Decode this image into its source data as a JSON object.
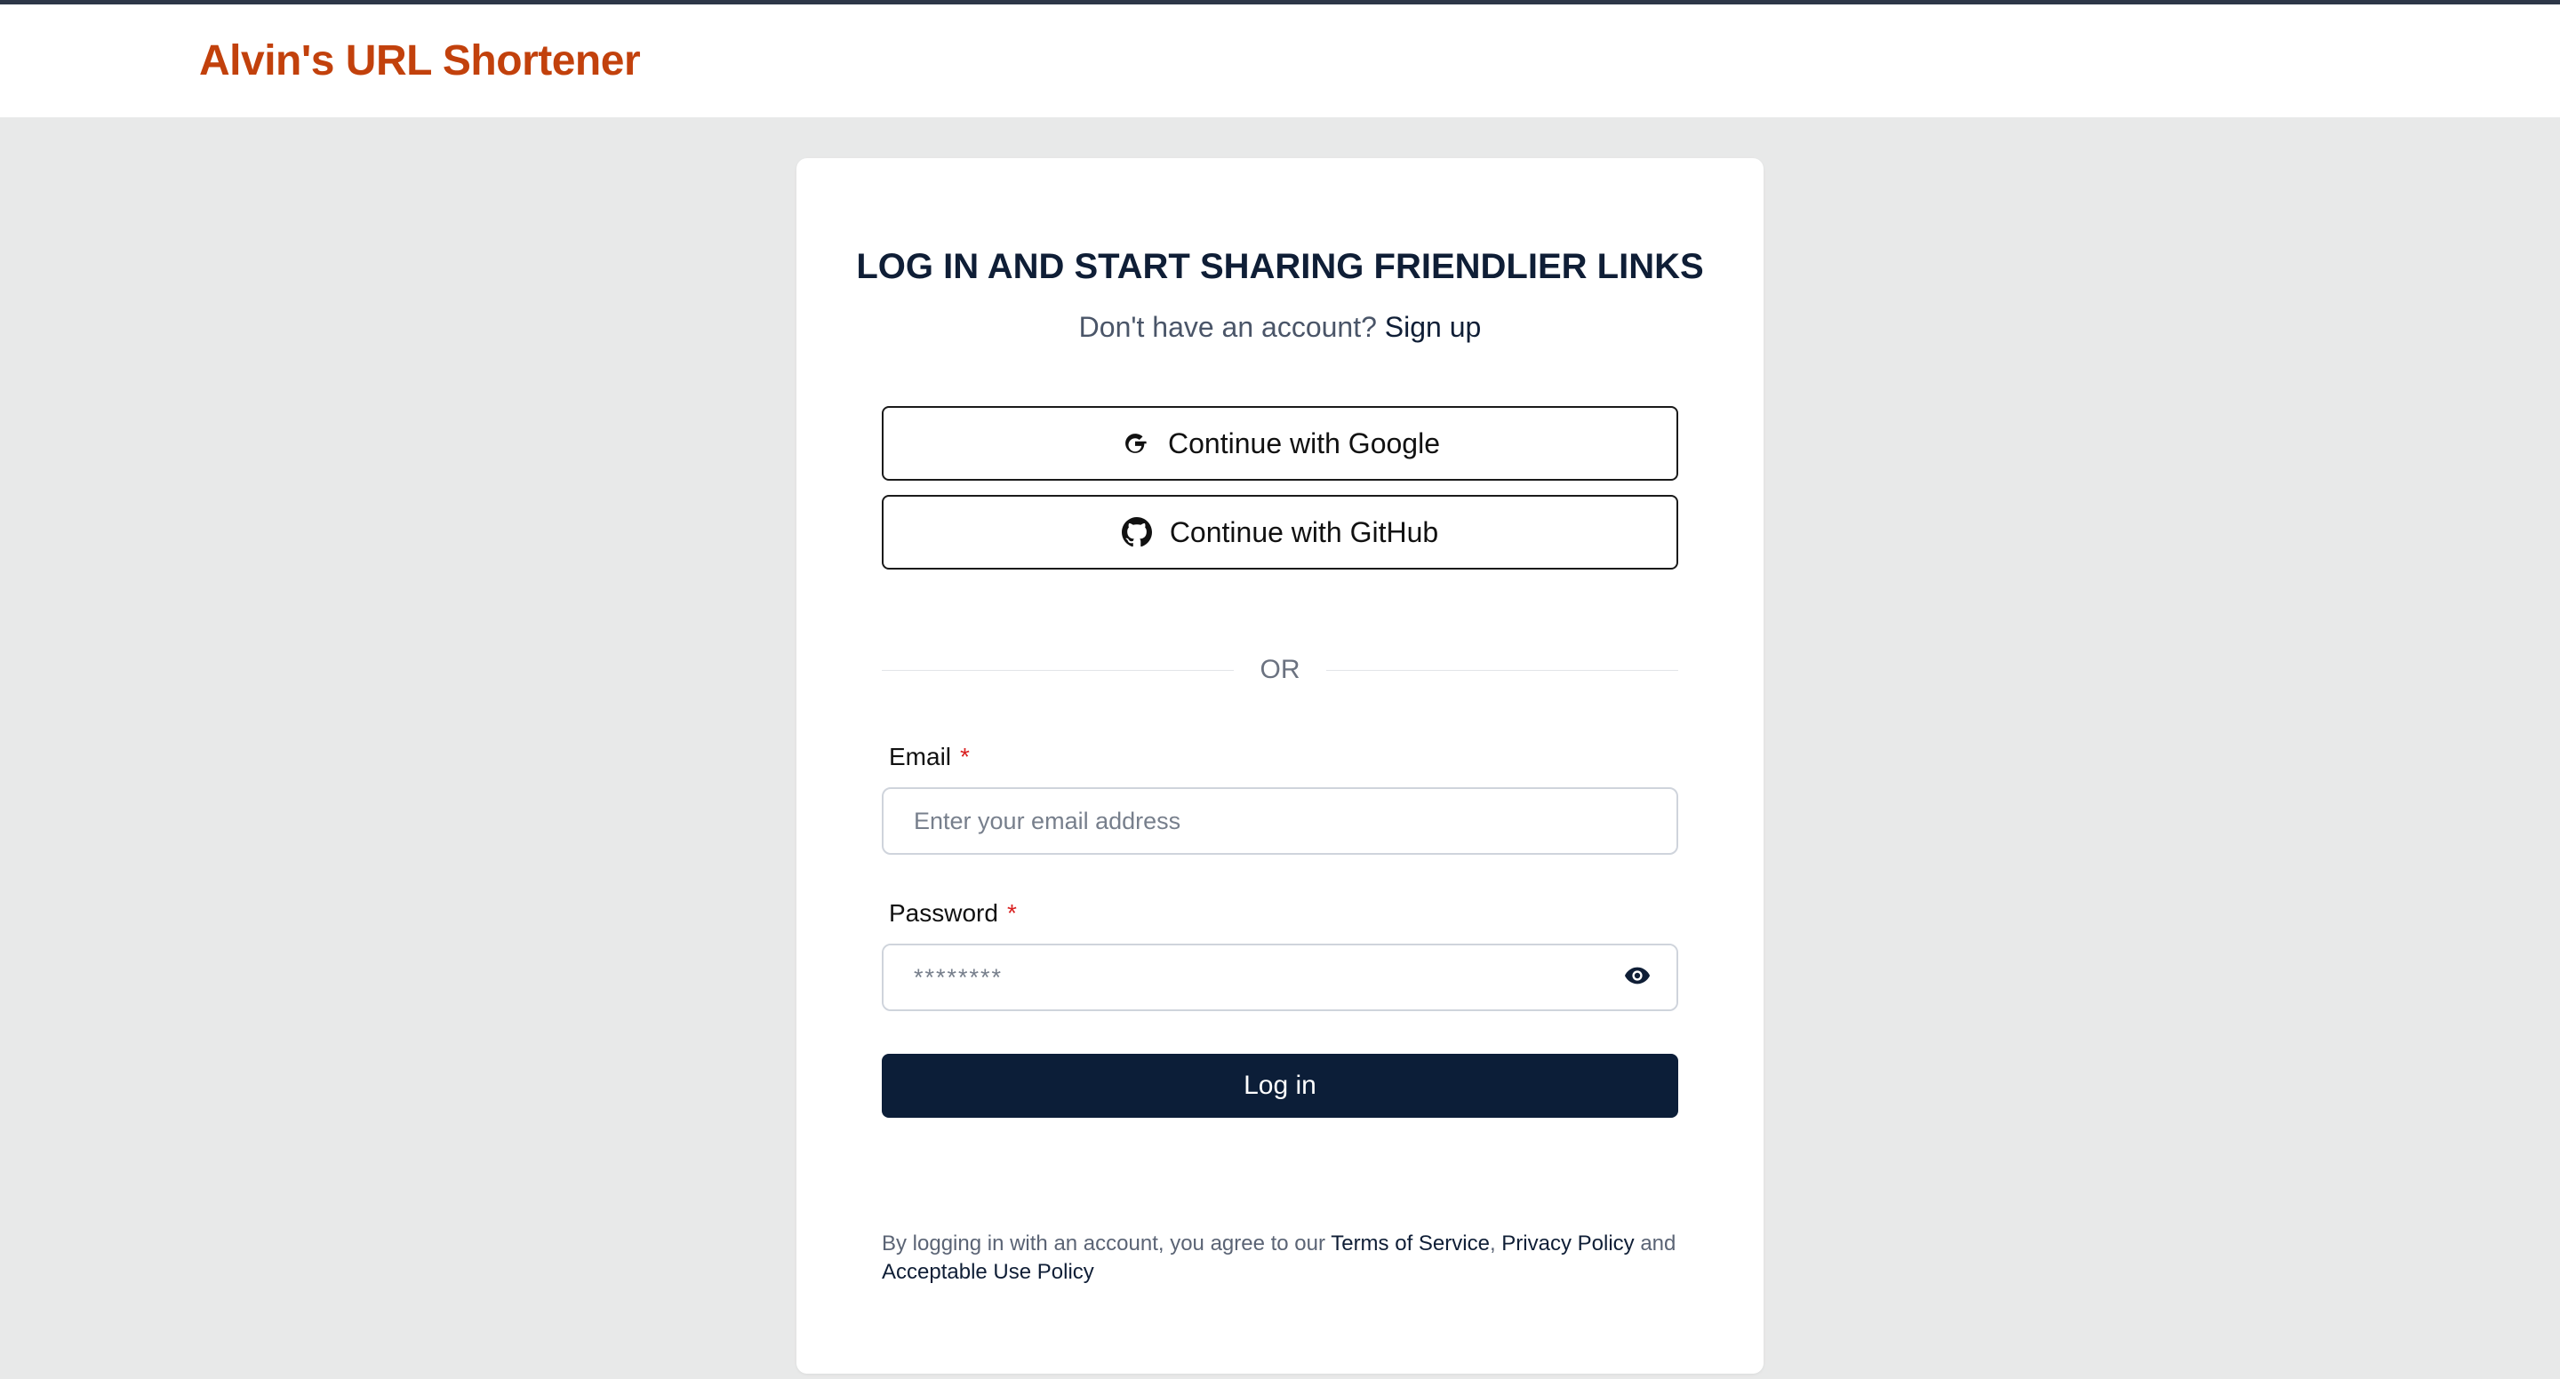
{
  "header": {
    "brand": "Alvin's URL Shortener"
  },
  "login": {
    "title": "LOG IN AND START SHARING FRIENDLIER LINKS",
    "no_account_text": "Don't have an account?",
    "signup_link": "Sign up",
    "google_button": "Continue with Google",
    "github_button": "Continue with GitHub",
    "divider_text": "OR",
    "email_label": "Email",
    "email_placeholder": "Enter your email address",
    "email_value": "",
    "password_label": "Password",
    "password_placeholder": "********",
    "password_value": "",
    "required_marker": "*",
    "submit_button": "Log in"
  },
  "legal": {
    "prefix": "By logging in with an account, you agree to our",
    "terms": "Terms of Service",
    "comma": ",",
    "privacy": "Privacy Policy",
    "and": "and",
    "aup": "Acceptable Use Policy"
  },
  "icons": {
    "google": "google-icon",
    "github": "github-icon",
    "eye": "eye-icon"
  },
  "colors": {
    "brand": "#c2410c",
    "primary": "#0c1e38",
    "background": "#e8e9e9",
    "required": "#d92020"
  }
}
